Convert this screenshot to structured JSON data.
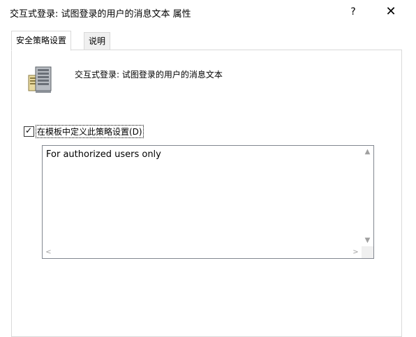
{
  "window": {
    "title": "交互式登录: 试图登录的用户的消息文本 属性",
    "help_label": "?",
    "close_label": "✕"
  },
  "tabs": [
    {
      "label": "安全策略设置",
      "active": true
    },
    {
      "label": "说明",
      "active": false
    }
  ],
  "policy": {
    "icon": "server-policy-icon",
    "name": "交互式登录: 试图登录的用户的消息文本"
  },
  "define_setting": {
    "checked": true,
    "label": "在模板中定义此策略设置(D)"
  },
  "message_text": {
    "value": "For authorized users only"
  },
  "icons": {
    "scroll_up": "▲",
    "scroll_down": "▼",
    "scroll_left": "<",
    "scroll_right": ">"
  }
}
